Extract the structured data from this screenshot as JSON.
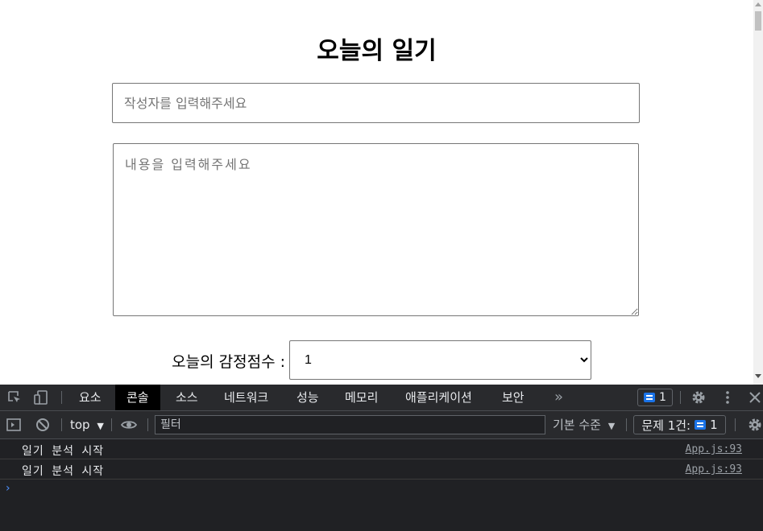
{
  "page": {
    "title": "오늘의 일기",
    "author_placeholder": "작성자를 입력해주세요",
    "content_placeholder": "내용을 입력해주세요",
    "emotion_label": "오늘의 감정점수 :",
    "emotion_value": "1",
    "emotion_options": [
      "1"
    ]
  },
  "devtools": {
    "tabs": [
      "요소",
      "콘솔",
      "소스",
      "네트워크",
      "성능",
      "메모리",
      "애플리케이션",
      "보안"
    ],
    "active_tab": "콘솔",
    "more_tabs": "»",
    "issue_count": "1",
    "context": "top",
    "filter_placeholder": "필터",
    "level": "기본 수준",
    "issues_label": "문제 1건:",
    "issues_count": "1",
    "logs": [
      {
        "text": "일기 분석 시작",
        "source": "App.js:93"
      },
      {
        "text": "일기 분석 시작",
        "source": "App.js:93"
      }
    ],
    "prompt": "›",
    "colors": {
      "accent": "#1a73e8",
      "panel": "#202124",
      "toolbar": "#292a2d"
    }
  }
}
